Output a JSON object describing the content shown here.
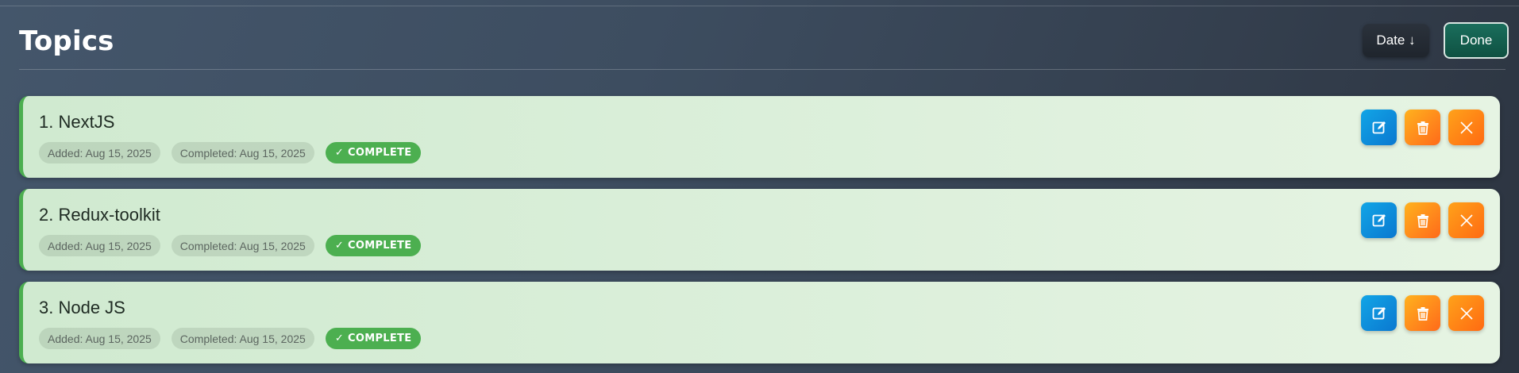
{
  "header": {
    "title": "Topics",
    "sort_label": "Date ↓",
    "done_label": "Done"
  },
  "topics": [
    {
      "title": "1. NextJS",
      "added": "Added: Aug 15, 2025",
      "completed": "Completed: Aug 15, 2025",
      "status": "COMPLETE",
      "status_icon": "✓"
    },
    {
      "title": "2. Redux-toolkit",
      "added": "Added: Aug 15, 2025",
      "completed": "Completed: Aug 15, 2025",
      "status": "COMPLETE",
      "status_icon": "✓"
    },
    {
      "title": "3. Node JS",
      "added": "Added: Aug 15, 2025",
      "completed": "Completed: Aug 15, 2025",
      "status": "COMPLETE",
      "status_icon": "✓"
    }
  ],
  "icons": {
    "edit": "edit-icon",
    "delete": "trash-icon",
    "close": "close-icon"
  },
  "colors": {
    "complete_green": "#4caf50",
    "edit_blue": "#0a78d0",
    "delete_orange": "#ff8c1a",
    "done_green": "#1a6e5c"
  }
}
